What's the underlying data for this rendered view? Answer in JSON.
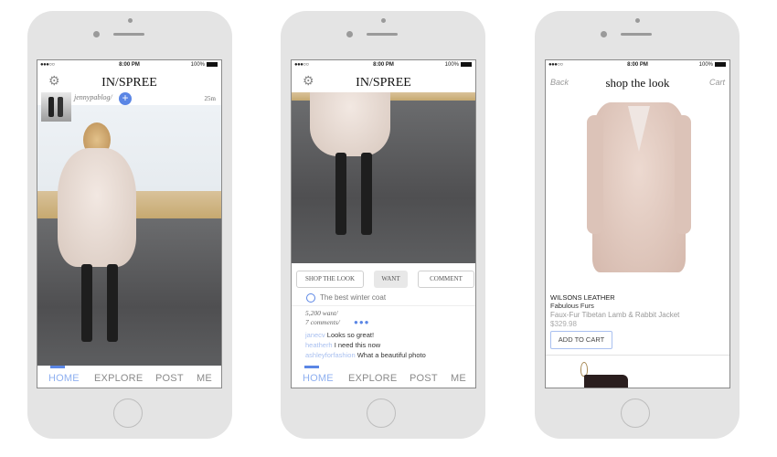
{
  "status_bar": {
    "signal": "●●●○○",
    "time": "8:00 PM",
    "battery": "100%"
  },
  "app": {
    "brand": "IN/SPREE",
    "settings_icon": "gear-icon"
  },
  "nav": {
    "items": [
      "HOME",
      "EXPLORE",
      "POST",
      "ME"
    ],
    "active": "HOME",
    "accent": "#5b86e5"
  },
  "feed": {
    "username": "jennypablog/",
    "time_ago": "25m",
    "follow_icon": "plus-icon"
  },
  "post": {
    "actions": [
      "SHOP THE LOOK",
      "WANT",
      "COMMENT"
    ],
    "caption": "The best winter coat",
    "wants": "5,200 want/",
    "comments_count": "7 comments/",
    "more_icon": "more-dots-icon",
    "comments": [
      {
        "user": "janecv",
        "text": "Looks so great!"
      },
      {
        "user": "heatherh",
        "text": "I need this now"
      },
      {
        "user": "ashleyforfashion",
        "text": "What a beautiful photo"
      }
    ]
  },
  "shop": {
    "back_label": "Back",
    "title": "shop the look",
    "cart_label": "Cart",
    "retailer": "WILSONS LEATHER",
    "brand": "Fabulous Furs",
    "product_name": "Faux-Fur Tibetan Lamb & Rabbit Jacket",
    "price": "$329.98",
    "add_to_cart_label": "ADD TO CART"
  }
}
